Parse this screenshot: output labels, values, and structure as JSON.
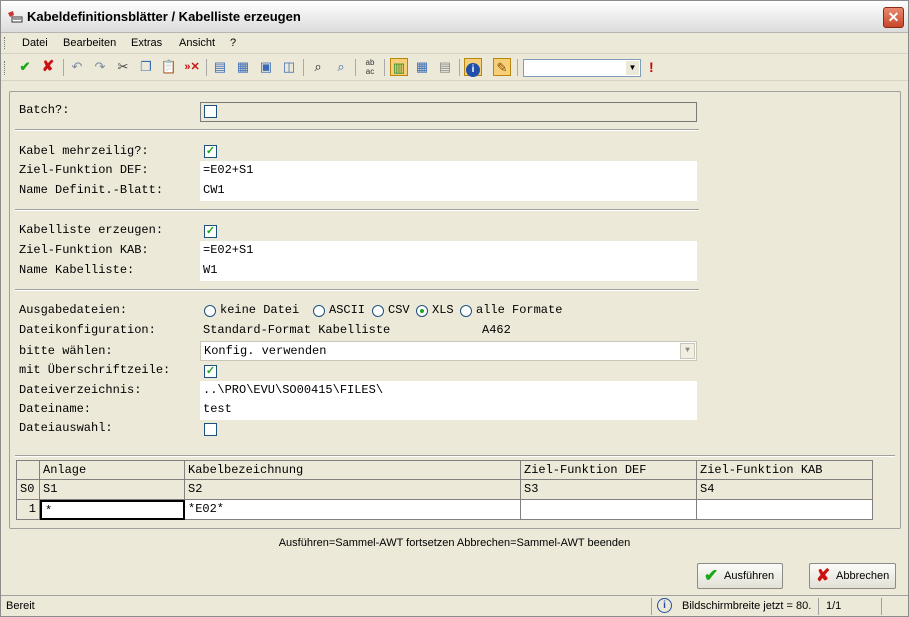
{
  "window": {
    "title": "Kabeldefinitionsblätter / Kabelliste erzeugen",
    "close_glyph": "✕"
  },
  "menu": [
    "Datei",
    "Bearbeiten",
    "Extras",
    "Ansicht",
    "?"
  ],
  "form": {
    "batch_label": "Batch?:",
    "multiline_label": "Kabel mehrzeilig?:",
    "target_def_label": "Ziel-Funktion DEF:",
    "target_def_value": "=E02+S1",
    "def_sheet_name_label": "Name Definit.-Blatt:",
    "def_sheet_name_value": "CW1",
    "create_list_label": "Kabelliste erzeugen:",
    "target_kab_label": "Ziel-Funktion KAB:",
    "target_kab_value": "=E02+S1",
    "list_name_label": "Name Kabelliste:",
    "list_name_value": "W1",
    "output_files_label": "Ausgabedateien:",
    "output_options": [
      "keine Datei",
      "ASCII",
      "CSV",
      "XLS",
      "alle Formate"
    ],
    "output_selected": "XLS",
    "file_config_label": "Dateikonfiguration:",
    "file_config_value": "Standard-Format Kabelliste",
    "file_config_code": "A462",
    "choose_label": "bitte wählen:",
    "choose_value": "Konfig. verwenden",
    "header_row_label": "mit Überschriftzeile:",
    "directory_label": "Dateiverzeichnis:",
    "directory_value": "..\\PRO\\EVU\\SO00415\\FILES\\",
    "filename_label": "Dateiname:",
    "filename_value": "test",
    "file_select_label": "Dateiauswahl:"
  },
  "grid": {
    "headers": [
      "",
      "Anlage",
      "Kabelbezeichnung",
      "Ziel-Funktion DEF",
      "Ziel-Funktion KAB"
    ],
    "subheaders": [
      "S0",
      "S1",
      "S2",
      "S3",
      "S4"
    ],
    "rows": [
      [
        "1",
        "*",
        "*E02*",
        "",
        ""
      ]
    ]
  },
  "hint": "Ausführen=Sammel-AWT fortsetzen Abbrechen=Sammel-AWT beenden",
  "buttons": {
    "run": "Ausführen",
    "cancel": "Abbrechen"
  },
  "status": {
    "state": "Bereit",
    "screen_width": "Bildschirmbreite jetzt = 80.",
    "page": "1/1"
  }
}
